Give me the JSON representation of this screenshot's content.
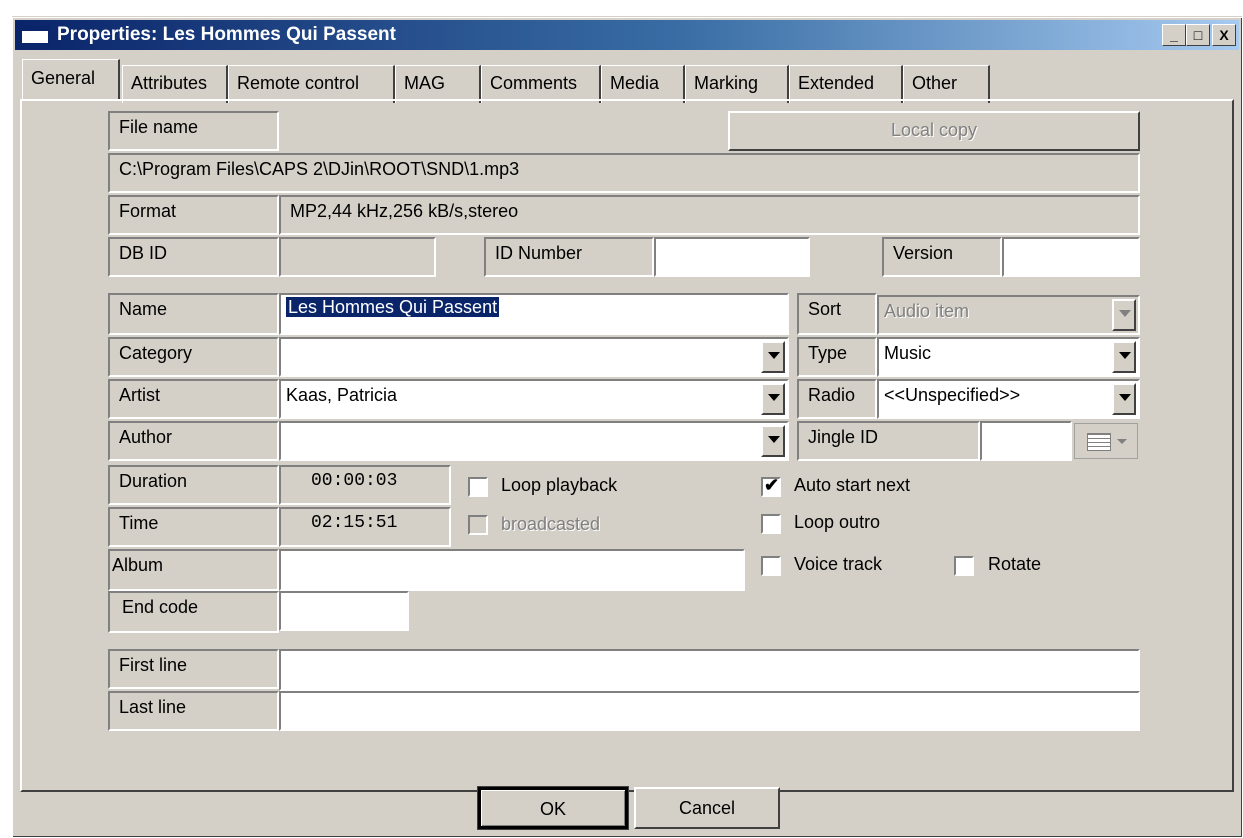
{
  "window": {
    "title": "Properties: Les Hommes Qui Passent",
    "minimize": "_",
    "maximize": "□",
    "close": "X"
  },
  "tabs": [
    "General",
    "Attributes",
    "Remote control",
    "MAG",
    "Comments",
    "Media",
    "Marking",
    "Extended",
    "Other"
  ],
  "file": {
    "label": "File name",
    "local_copy_button": "Local copy",
    "path": "C:\\Program Files\\CAPS 2\\DJin\\ROOT\\SND\\1.mp3",
    "format_label": "Format",
    "format_value": "MP2,44 kHz,256 kB/s,stereo",
    "dbid_label": "DB ID",
    "dbid_value": "",
    "idnumber_label": "ID Number",
    "idnumber_value": "",
    "version_label": "Version",
    "version_value": ""
  },
  "fields": {
    "name_label": "Name",
    "name_value": "Les Hommes Qui Passent",
    "category_label": "Category",
    "category_value": "",
    "artist_label": "Artist",
    "artist_value": "Kaas, Patricia",
    "author_label": "Author",
    "author_value": "",
    "sort_label": "Sort",
    "sort_value": "Audio item",
    "type_label": "Type",
    "type_value": "Music",
    "radio_label": "Radio",
    "radio_value": "<<Unspecified>>",
    "jingle_label": "Jingle ID",
    "jingle_value": "",
    "duration_label": "Duration",
    "duration_value": "00:00:03",
    "time_label": "Time",
    "time_value": "02:15:51",
    "album_label": "Album",
    "album_value": "",
    "endcode_label": "End code",
    "endcode_value": "",
    "firstline_label": "First line",
    "firstline_value": "",
    "lastline_label": "Last line",
    "lastline_value": ""
  },
  "checkboxes": {
    "loop_playback": {
      "label": "Loop playback",
      "checked": false
    },
    "broadcasted": {
      "label": "broadcasted",
      "checked": false,
      "disabled": true
    },
    "auto_start_next": {
      "label": "Auto start next",
      "checked": true
    },
    "loop_outro": {
      "label": "Loop outro",
      "checked": false
    },
    "voice_track": {
      "label": "Voice track",
      "checked": false
    },
    "rotate": {
      "label": "Rotate",
      "checked": false
    }
  },
  "buttons": {
    "ok": "OK",
    "cancel": "Cancel"
  },
  "colors": {
    "title_start": "#0a246a",
    "title_end": "#a6caf0",
    "face": "#d4d0c8",
    "selection": "#0a246a"
  }
}
